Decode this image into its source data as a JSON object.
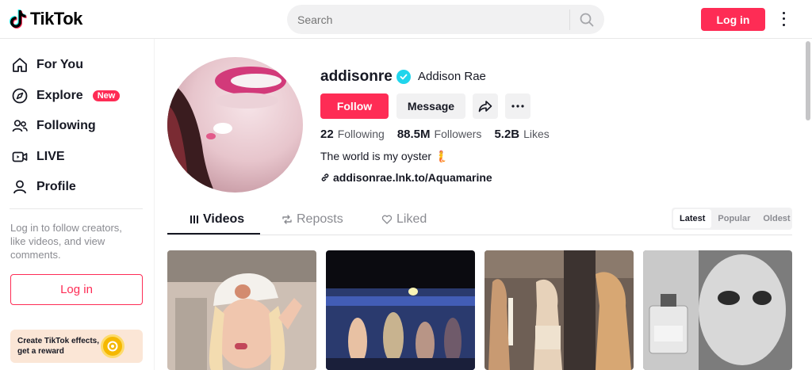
{
  "header": {
    "logo_text": "TikTok",
    "search_placeholder": "Search",
    "login_label": "Log in"
  },
  "sidebar": {
    "items": [
      {
        "label": "For You",
        "icon": "home-icon"
      },
      {
        "label": "Explore",
        "icon": "compass-icon",
        "badge": "New"
      },
      {
        "label": "Following",
        "icon": "users-icon"
      },
      {
        "label": "LIVE",
        "icon": "live-icon"
      },
      {
        "label": "Profile",
        "icon": "person-icon"
      }
    ],
    "prompt_text": "Log in to follow creators, like videos, and view comments.",
    "login_label": "Log in",
    "promo_text": "Create TikTok effects, get a reward"
  },
  "profile": {
    "username": "addisonre",
    "display_name": "Addison Rae",
    "follow_label": "Follow",
    "message_label": "Message",
    "following_count": "22",
    "following_label": "Following",
    "followers_count": "88.5M",
    "followers_label": "Followers",
    "likes_count": "5.2B",
    "likes_label": "Likes",
    "bio": "The world is my oyster 🧜",
    "link": "addisonrae.lnk.to/Aquamarine"
  },
  "tabs": [
    {
      "label": "Videos",
      "icon": "grid-icon",
      "active": true
    },
    {
      "label": "Reposts",
      "icon": "repost-icon",
      "active": false
    },
    {
      "label": "Liked",
      "icon": "heart-lock-icon",
      "active": false
    }
  ],
  "sort": {
    "options": [
      "Latest",
      "Popular",
      "Oldest"
    ],
    "selected": "Latest"
  },
  "colors": {
    "brand": "#fe2c55",
    "verified": "#20d5ec"
  }
}
